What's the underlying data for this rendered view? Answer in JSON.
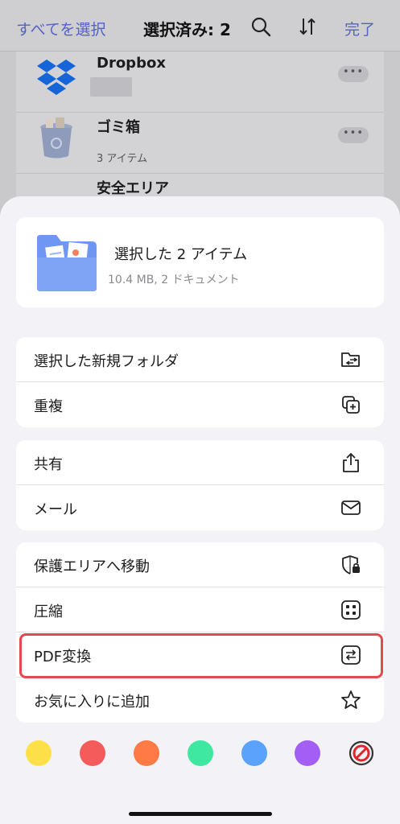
{
  "topbar": {
    "select_all": "すべてを選択",
    "title": "選択済み: 2",
    "done": "完了",
    "search_icon": "search-icon",
    "sort_icon": "sort-icon"
  },
  "background_list": [
    {
      "name": "Dropbox",
      "subtitle": "",
      "icon": "dropbox-icon"
    },
    {
      "name": "ゴミ箱",
      "subtitle": "3 アイテム",
      "icon": "trash-icon"
    },
    {
      "name": "安全エリア",
      "subtitle": "",
      "icon": "folder-icon"
    }
  ],
  "sheet": {
    "header": {
      "title": "選択した 2 アイテム",
      "subtitle": "10.4 MB, 2 ドキュメント"
    },
    "groups": [
      [
        {
          "label": "選択した新規フォルダ",
          "icon": "new-folder-icon"
        },
        {
          "label": "重複",
          "icon": "duplicate-icon"
        }
      ],
      [
        {
          "label": "共有",
          "icon": "share-icon"
        },
        {
          "label": "メール",
          "icon": "mail-icon"
        }
      ],
      [
        {
          "label": "保護エリアへ移動",
          "icon": "shield-lock-icon"
        },
        {
          "label": "圧縮",
          "icon": "compress-icon"
        },
        {
          "label": "PDF変換",
          "icon": "convert-icon"
        },
        {
          "label": "お気に入りに追加",
          "icon": "star-icon"
        }
      ]
    ],
    "tag_colors": [
      "#fde047",
      "#f45b5b",
      "#ff7a45",
      "#3ee8a0",
      "#5aa2fb",
      "#a35ef5"
    ],
    "no_tag_icon": "no-tag-icon",
    "accent": "#5562c4",
    "highlight_color": "#e5484d"
  }
}
